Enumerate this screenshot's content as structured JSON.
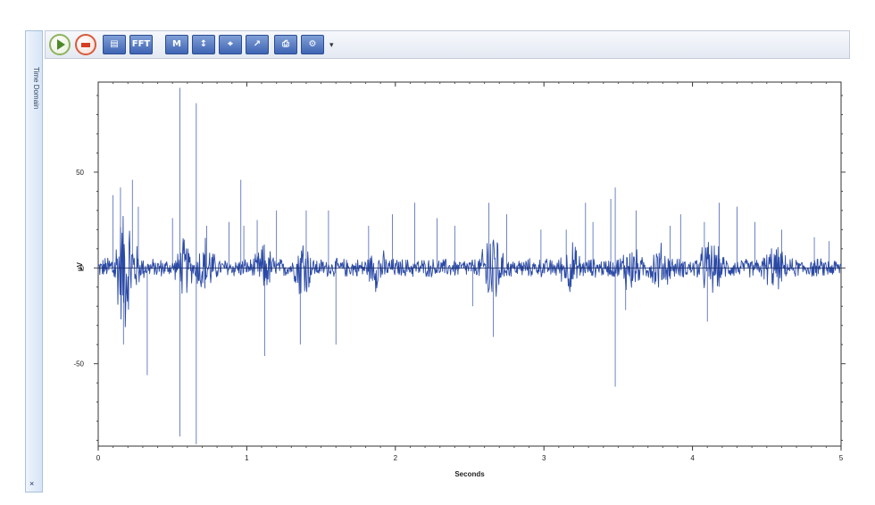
{
  "side_tab": {
    "label": "Time Domain",
    "close_glyph": "×"
  },
  "toolbar": {
    "buttons": [
      {
        "name": "play-button",
        "icon": "play-icon"
      },
      {
        "name": "stop-button",
        "icon": "stop-icon"
      },
      {
        "name": "export-button",
        "icon": "export-icon",
        "glyph": "▤"
      },
      {
        "name": "fft-button",
        "icon": "fft-icon",
        "glyph": "FFT"
      },
      {
        "name": "marker-button",
        "icon": "marker-icon",
        "glyph": "M"
      },
      {
        "name": "scale-button",
        "icon": "scale-icon",
        "glyph": "↕"
      },
      {
        "name": "cursor-button",
        "icon": "cursor-icon",
        "glyph": "⌖"
      },
      {
        "name": "zoom-button",
        "icon": "zoom-icon",
        "glyph": "↗"
      },
      {
        "name": "print-button",
        "icon": "print-icon",
        "glyph": "⎙"
      },
      {
        "name": "settings-button",
        "icon": "settings-icon",
        "glyph": "⚙"
      }
    ],
    "dropdown_glyph": "▾"
  },
  "chart_data": {
    "type": "line",
    "xlabel": "Seconds",
    "ylabel": "µV",
    "xlim": [
      0,
      5
    ],
    "ylim": [
      -93,
      97
    ],
    "xticks": [
      0,
      1,
      2,
      3,
      4,
      5
    ],
    "yticks": [
      50,
      0,
      -50
    ],
    "ytick_labels": [
      "50",
      "0",
      "-50"
    ],
    "series_color": "#2b4aa6",
    "baseline_envelope": 5,
    "bursts": [
      {
        "t": 0.18,
        "amp": 30,
        "width": 0.07
      },
      {
        "t": 0.58,
        "amp": 12,
        "width": 0.04
      },
      {
        "t": 0.72,
        "amp": 14,
        "width": 0.05
      },
      {
        "t": 1.12,
        "amp": 9,
        "width": 0.05
      },
      {
        "t": 1.38,
        "amp": 18,
        "width": 0.04
      },
      {
        "t": 1.88,
        "amp": 8,
        "width": 0.05
      },
      {
        "t": 2.65,
        "amp": 26,
        "width": 0.05
      },
      {
        "t": 3.18,
        "amp": 10,
        "width": 0.05
      },
      {
        "t": 3.58,
        "amp": 11,
        "width": 0.05
      },
      {
        "t": 3.78,
        "amp": 9,
        "width": 0.06
      },
      {
        "t": 4.12,
        "amp": 11,
        "width": 0.07
      },
      {
        "t": 4.55,
        "amp": 8,
        "width": 0.06
      }
    ],
    "spikes": [
      {
        "t": 0.1,
        "v": 38
      },
      {
        "t": 0.15,
        "v": 42
      },
      {
        "t": 0.23,
        "v": 46
      },
      {
        "t": 0.27,
        "v": 32
      },
      {
        "t": 0.17,
        "v": -40
      },
      {
        "t": 0.33,
        "v": -56
      },
      {
        "t": 0.55,
        "v": 94
      },
      {
        "t": 0.55,
        "v": -88
      },
      {
        "t": 0.66,
        "v": 86
      },
      {
        "t": 0.66,
        "v": -92
      },
      {
        "t": 0.5,
        "v": 26
      },
      {
        "t": 0.73,
        "v": 22
      },
      {
        "t": 0.88,
        "v": 24
      },
      {
        "t": 0.98,
        "v": 22
      },
      {
        "t": 1.07,
        "v": 25
      },
      {
        "t": 1.12,
        "v": -46
      },
      {
        "t": 0.96,
        "v": 46
      },
      {
        "t": 1.2,
        "v": 30
      },
      {
        "t": 1.4,
        "v": 30
      },
      {
        "t": 1.36,
        "v": -40
      },
      {
        "t": 1.55,
        "v": 30
      },
      {
        "t": 1.6,
        "v": -40
      },
      {
        "t": 1.82,
        "v": 22
      },
      {
        "t": 1.98,
        "v": 28
      },
      {
        "t": 2.13,
        "v": 34
      },
      {
        "t": 2.28,
        "v": 26
      },
      {
        "t": 2.4,
        "v": 22
      },
      {
        "t": 2.52,
        "v": -20
      },
      {
        "t": 2.63,
        "v": 34
      },
      {
        "t": 2.66,
        "v": -36
      },
      {
        "t": 2.75,
        "v": 28
      },
      {
        "t": 2.98,
        "v": 20
      },
      {
        "t": 3.15,
        "v": 20
      },
      {
        "t": 3.28,
        "v": 34
      },
      {
        "t": 3.33,
        "v": 24
      },
      {
        "t": 3.45,
        "v": 36
      },
      {
        "t": 3.48,
        "v": 42
      },
      {
        "t": 3.48,
        "v": -62
      },
      {
        "t": 3.55,
        "v": -22
      },
      {
        "t": 3.62,
        "v": 30
      },
      {
        "t": 3.85,
        "v": 22
      },
      {
        "t": 3.92,
        "v": 28
      },
      {
        "t": 4.08,
        "v": 24
      },
      {
        "t": 4.1,
        "v": -28
      },
      {
        "t": 4.18,
        "v": 34
      },
      {
        "t": 4.3,
        "v": 32
      },
      {
        "t": 4.42,
        "v": 24
      },
      {
        "t": 4.6,
        "v": 20
      },
      {
        "t": 4.82,
        "v": 16
      },
      {
        "t": 4.92,
        "v": 14
      }
    ]
  }
}
